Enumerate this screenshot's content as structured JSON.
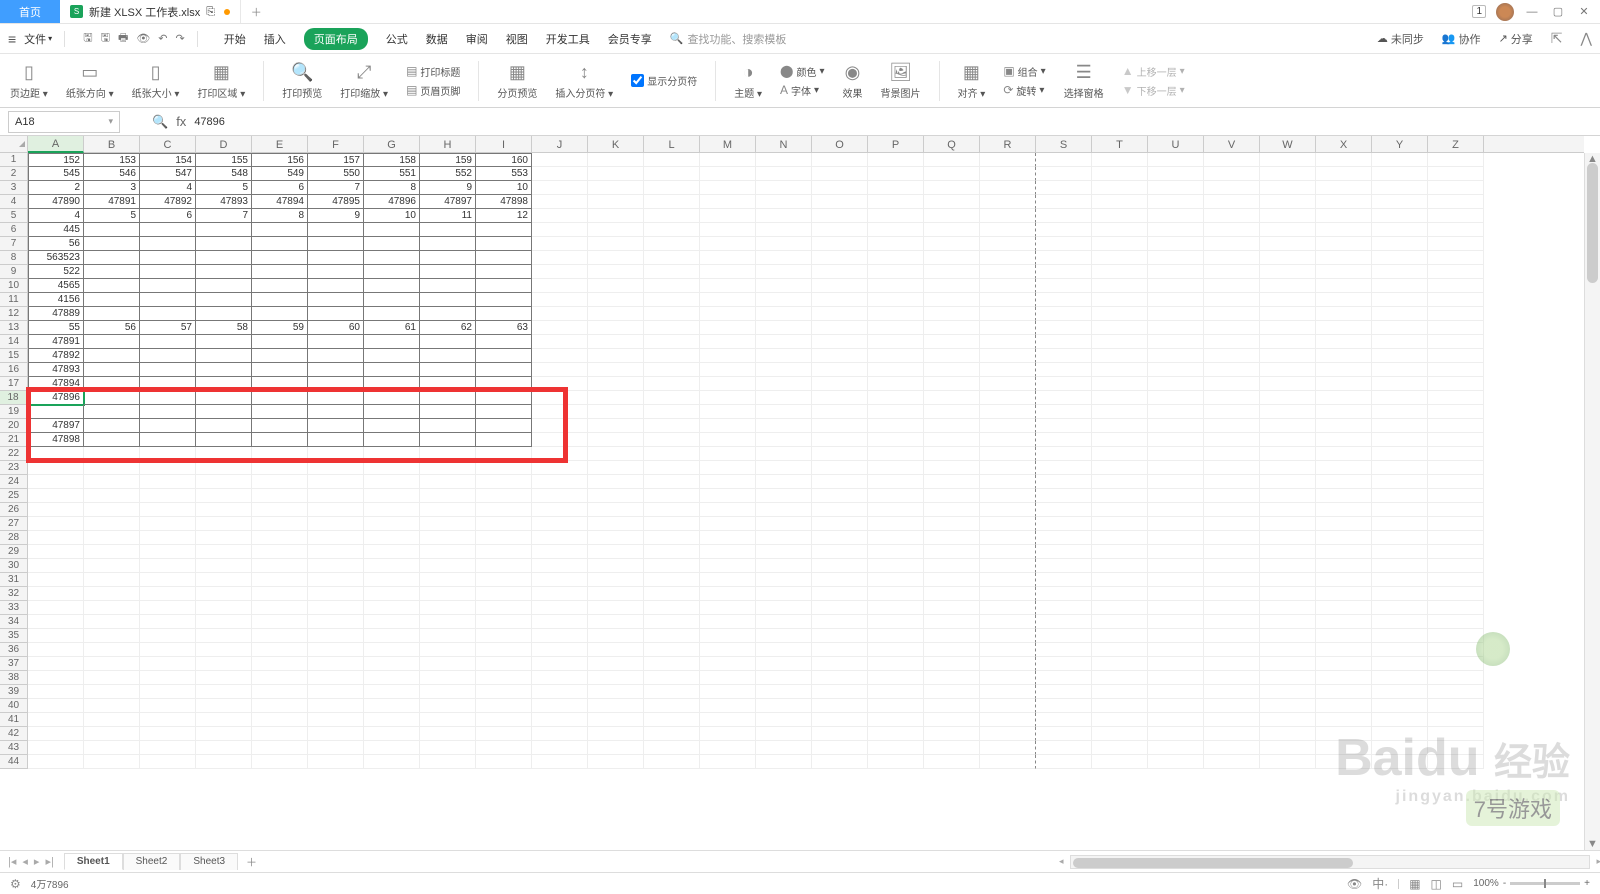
{
  "titlebar": {
    "home": "首页",
    "file_name": "新建 XLSX 工作表.xlsx",
    "file_badge": "S",
    "page_indicator": "1"
  },
  "menu": {
    "file_label": "文件",
    "tabs": [
      "开始",
      "插入",
      "页面布局",
      "公式",
      "数据",
      "审阅",
      "视图",
      "开发工具",
      "会员专享"
    ],
    "active_tab": "页面布局",
    "search_placeholder": "查找功能、搜索模板",
    "right": {
      "sync": "未同步",
      "coop": "协作",
      "share": "分享"
    }
  },
  "ribbon": {
    "margin": "页边距",
    "orient": "纸张方向",
    "size": "纸张大小",
    "area": "打印区域",
    "preview": "打印预览",
    "scale": "打印缩放",
    "title": "打印标题",
    "headerfooter": "页眉页脚",
    "pagebreak_view": "分页预览",
    "insert_break": "插入分页符",
    "show_breaks": "显示分页符",
    "themes": "主题",
    "colors": "颜色",
    "fonts": "字体",
    "effects": "效果",
    "bg": "背景图片",
    "align": "对齐",
    "group": "组合",
    "rotate": "旋转",
    "pane": "选择窗格",
    "moveup": "上移一层",
    "movedown": "下移一层"
  },
  "formula": {
    "name_box": "A18",
    "fx": "fx",
    "value": "47896"
  },
  "columns": [
    "A",
    "B",
    "C",
    "D",
    "E",
    "F",
    "G",
    "H",
    "I",
    "J",
    "K",
    "L",
    "M",
    "N",
    "O",
    "P",
    "Q",
    "R",
    "S",
    "T",
    "U",
    "V",
    "W",
    "X",
    "Y",
    "Z"
  ],
  "row_count": 44,
  "active": {
    "row": 18,
    "col": 0
  },
  "data_rows": [
    [
      "152",
      "153",
      "154",
      "155",
      "156",
      "157",
      "158",
      "159",
      "160"
    ],
    [
      "545",
      "546",
      "547",
      "548",
      "549",
      "550",
      "551",
      "552",
      "553"
    ],
    [
      "2",
      "3",
      "4",
      "5",
      "6",
      "7",
      "8",
      "9",
      "10"
    ],
    [
      "47890",
      "47891",
      "47892",
      "47893",
      "47894",
      "47895",
      "47896",
      "47897",
      "47898"
    ],
    [
      "4",
      "5",
      "6",
      "7",
      "8",
      "9",
      "10",
      "11",
      "12"
    ],
    [
      "445",
      "",
      "",
      "",
      "",
      "",
      "",
      "",
      ""
    ],
    [
      "56",
      "",
      "",
      "",
      "",
      "",
      "",
      "",
      ""
    ],
    [
      "563523",
      "",
      "",
      "",
      "",
      "",
      "",
      "",
      ""
    ],
    [
      "522",
      "",
      "",
      "",
      "",
      "",
      "",
      "",
      ""
    ],
    [
      "4565",
      "",
      "",
      "",
      "",
      "",
      "",
      "",
      ""
    ],
    [
      "4156",
      "",
      "",
      "",
      "",
      "",
      "",
      "",
      ""
    ],
    [
      "47889",
      "",
      "",
      "",
      "",
      "",
      "",
      "",
      ""
    ],
    [
      "55",
      "56",
      "57",
      "58",
      "59",
      "60",
      "61",
      "62",
      "63"
    ],
    [
      "47891",
      "",
      "",
      "",
      "",
      "",
      "",
      "",
      ""
    ],
    [
      "47892",
      "",
      "",
      "",
      "",
      "",
      "",
      "",
      ""
    ],
    [
      "47893",
      "",
      "",
      "",
      "",
      "",
      "",
      "",
      ""
    ],
    [
      "47894",
      "",
      "",
      "",
      "",
      "",
      "",
      "",
      ""
    ],
    [
      "47896",
      "",
      "",
      "",
      "",
      "",
      "",
      "",
      ""
    ],
    [
      "",
      "",
      "",
      "",
      "",
      "",
      "",
      "",
      ""
    ],
    [
      "47897",
      "",
      "",
      "",
      "",
      "",
      "",
      "",
      ""
    ],
    [
      "47898",
      "",
      "",
      "",
      "",
      "",
      "",
      "",
      ""
    ]
  ],
  "bordered_cols": 9,
  "bordered_rows": 21,
  "sheets": {
    "active": "Sheet1",
    "list": [
      "Sheet1",
      "Sheet2",
      "Sheet3"
    ]
  },
  "status": {
    "left": "4万7896",
    "zoom": "100%"
  },
  "watermark": {
    "main": "Baidu",
    "sub": "经验",
    "url": "jingyan.baidu.com",
    "logo": "7号游戏"
  }
}
